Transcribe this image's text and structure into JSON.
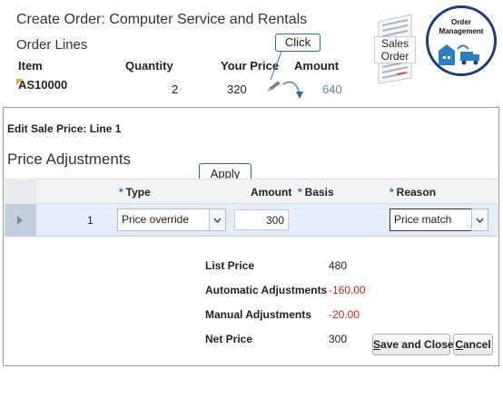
{
  "header": {
    "title": "Create Order: Computer Service and Rentals",
    "subtitle": "Order Lines"
  },
  "order_lines": {
    "columns": [
      "Item",
      "Quantity",
      "Your Price",
      "Amount"
    ],
    "row": {
      "item": "AS10000",
      "quantity": "2",
      "your_price": "320",
      "amount": "640"
    }
  },
  "callouts": {
    "click": "Click",
    "apply": "Apply"
  },
  "graphics": {
    "sales_order_label_1": "Sales",
    "sales_order_label_2": "Order",
    "badge_label_1": "Order",
    "badge_label_2": "Management"
  },
  "dialog": {
    "title": "Edit Sale Price: Line 1",
    "section_title": "Price Adjustments",
    "grid": {
      "columns": {
        "type": "Type",
        "amount": "Amount",
        "basis": "Basis",
        "reason": "Reason"
      },
      "row": {
        "number": "1",
        "type": "Price override",
        "amount": "300",
        "reason": "Price match"
      }
    },
    "summary": [
      {
        "label": "List Price",
        "value": "480"
      },
      {
        "label": "Automatic Adjustments",
        "value": "-160.00"
      },
      {
        "label": "Manual Adjustments",
        "value": "-20.00"
      },
      {
        "label": "Net Price",
        "value": "300"
      }
    ],
    "buttons": {
      "save_close_mnemonic": "S",
      "save_close_rest": "ave and Close",
      "cancel_mnemonic": "C",
      "cancel_rest": "ancel"
    }
  },
  "colors": {
    "accent": "#2c6eb5",
    "negative": "#d21f1f",
    "link": "#5a86b8",
    "selected_row": "#e3eef9"
  }
}
